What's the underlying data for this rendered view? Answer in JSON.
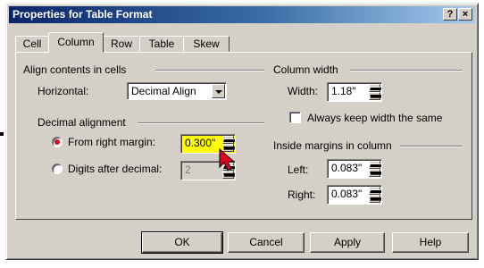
{
  "window": {
    "title": "Properties for Table Format",
    "help_btn": "?",
    "close_btn": "×"
  },
  "tabs": [
    "Cell",
    "Column",
    "Row",
    "Table",
    "Skew"
  ],
  "active_tab": "Column",
  "align_group": {
    "title": "Align contents in cells",
    "horizontal_label": "Horizontal:",
    "horizontal_value": "Decimal Align"
  },
  "decimal_group": {
    "title": "Decimal alignment",
    "from_right_label": "From right margin:",
    "from_right_value": "0.300\"",
    "digits_label": "Digits after decimal:",
    "digits_value": "2"
  },
  "width_group": {
    "title": "Column width",
    "width_label": "Width:",
    "width_value": "1.18\"",
    "keep_width_label": "Always keep width the same"
  },
  "margins_group": {
    "title": "Inside margins in column",
    "left_label": "Left:",
    "left_value": "0.083\"",
    "right_label": "Right:",
    "right_value": "0.083\""
  },
  "buttons": {
    "ok": "OK",
    "cancel": "Cancel",
    "apply": "Apply",
    "help": "Help"
  },
  "colors": {
    "highlight_field": "#ffff00",
    "radio_selected": "#e0001b",
    "cursor": "#e0001b"
  }
}
